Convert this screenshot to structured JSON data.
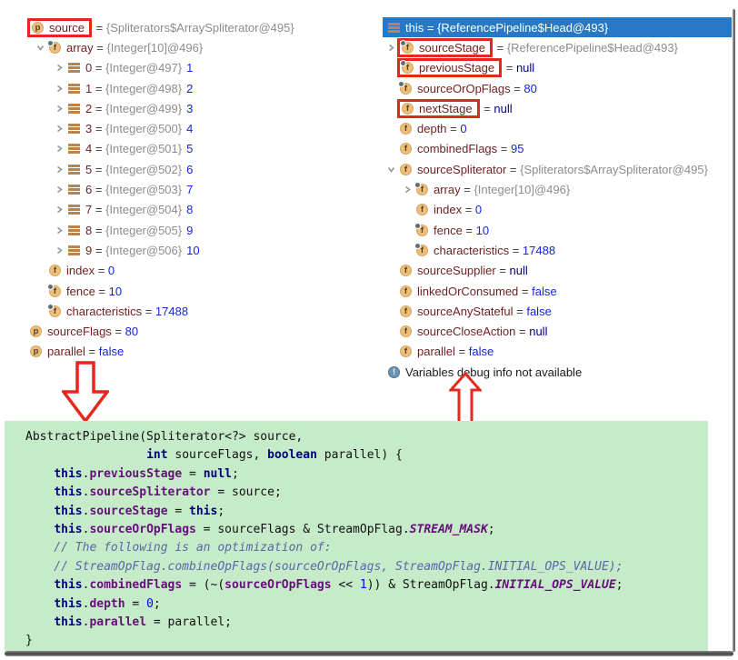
{
  "colors": {
    "selection_bg": "#2779c7",
    "annotation_red": "#e6271c",
    "code_background": "#c6ebc9",
    "icon_background": "#ecbe7a",
    "variable_name": "#6e2222",
    "value_reference": "#8c8c8c",
    "value_primitive": "#1426d8",
    "value_null": "#000080"
  },
  "left_panel": {
    "rows": [
      {
        "pad": 0,
        "icon": "p",
        "name": "source",
        "value": "{Spliterators$ArraySpliterator@495}",
        "vt": "ref",
        "boxed": true
      },
      {
        "pad": 21,
        "chev": "open",
        "icon": "ff",
        "name": "array",
        "value": "{Integer[10]@496}",
        "vt": "ref"
      },
      {
        "pad": 42,
        "chev": "closed",
        "icon": "item",
        "name": "0",
        "value": "{Integer@497}",
        "vt": "ref",
        "extra": "1"
      },
      {
        "pad": 42,
        "chev": "closed",
        "icon": "item",
        "name": "1",
        "value": "{Integer@498}",
        "vt": "ref",
        "extra": "2"
      },
      {
        "pad": 42,
        "chev": "closed",
        "icon": "item",
        "name": "2",
        "value": "{Integer@499}",
        "vt": "ref",
        "extra": "3"
      },
      {
        "pad": 42,
        "chev": "closed",
        "icon": "item",
        "name": "3",
        "value": "{Integer@500}",
        "vt": "ref",
        "extra": "4"
      },
      {
        "pad": 42,
        "chev": "closed",
        "icon": "item",
        "name": "4",
        "value": "{Integer@501}",
        "vt": "ref",
        "extra": "5"
      },
      {
        "pad": 42,
        "chev": "closed",
        "icon": "item",
        "name": "5",
        "value": "{Integer@502}",
        "vt": "ref",
        "extra": "6"
      },
      {
        "pad": 42,
        "chev": "closed",
        "icon": "item",
        "name": "6",
        "value": "{Integer@503}",
        "vt": "ref",
        "extra": "7"
      },
      {
        "pad": 42,
        "chev": "closed",
        "icon": "item",
        "name": "7",
        "value": "{Integer@504}",
        "vt": "ref",
        "extra": "8"
      },
      {
        "pad": 42,
        "chev": "closed",
        "icon": "item",
        "name": "8",
        "value": "{Integer@505}",
        "vt": "ref",
        "extra": "9"
      },
      {
        "pad": 42,
        "chev": "closed",
        "icon": "item",
        "name": "9",
        "value": "{Integer@506}",
        "vt": "ref",
        "extra": "10"
      },
      {
        "pad": 21,
        "icon": "f",
        "name": "index",
        "value": "0",
        "vt": "num"
      },
      {
        "pad": 21,
        "icon": "ff",
        "name": "fence",
        "value": "10",
        "vt": "num"
      },
      {
        "pad": 21,
        "icon": "ff",
        "name": "characteristics",
        "value": "17488",
        "vt": "num"
      },
      {
        "pad": 0,
        "icon": "p",
        "name": "sourceFlags",
        "value": "80",
        "vt": "num"
      },
      {
        "pad": 0,
        "icon": "p",
        "name": "parallel",
        "value": "false",
        "vt": "num"
      }
    ]
  },
  "right_panel": {
    "rows": [
      {
        "selected": true,
        "pad": 6,
        "icon": "this",
        "name": "this",
        "value": "{ReferencePipeline$Head@493}",
        "vt": "ref"
      },
      {
        "pad": 0,
        "chev": "closed",
        "icon": "ff",
        "name": "sourceStage",
        "value": "{ReferencePipeline$Head@493}",
        "vt": "ref",
        "boxed": true
      },
      {
        "pad": 0,
        "icon": "ff",
        "name": "previousStage",
        "value": "null",
        "vt": "null",
        "boxed": true
      },
      {
        "pad": 0,
        "icon": "ff",
        "name": "sourceOrOpFlags",
        "value": "80",
        "vt": "num"
      },
      {
        "pad": 0,
        "icon": "f",
        "name": "nextStage",
        "value": "null",
        "vt": "null",
        "boxed": true
      },
      {
        "pad": 0,
        "icon": "f",
        "name": "depth",
        "value": "0",
        "vt": "num"
      },
      {
        "pad": 0,
        "icon": "f",
        "name": "combinedFlags",
        "value": "95",
        "vt": "num"
      },
      {
        "pad": 0,
        "chev": "open",
        "icon": "f",
        "name": "sourceSpliterator",
        "value": "{Spliterators$ArraySpliterator@495}",
        "vt": "ref"
      },
      {
        "pad": 18,
        "chev": "closed",
        "icon": "ff",
        "name": "array",
        "value": "{Integer[10]@496}",
        "vt": "ref"
      },
      {
        "pad": 18,
        "icon": "f",
        "name": "index",
        "value": "0",
        "vt": "num"
      },
      {
        "pad": 18,
        "icon": "ff",
        "name": "fence",
        "value": "10",
        "vt": "num"
      },
      {
        "pad": 18,
        "icon": "ff",
        "name": "characteristics",
        "value": "17488",
        "vt": "num"
      },
      {
        "pad": 0,
        "icon": "f",
        "name": "sourceSupplier",
        "value": "null",
        "vt": "null"
      },
      {
        "pad": 0,
        "icon": "f",
        "name": "linkedOrConsumed",
        "value": "false",
        "vt": "num"
      },
      {
        "pad": 0,
        "icon": "f",
        "name": "sourceAnyStateful",
        "value": "false",
        "vt": "num"
      },
      {
        "pad": 0,
        "icon": "f",
        "name": "sourceCloseAction",
        "value": "null",
        "vt": "null"
      },
      {
        "pad": 0,
        "icon": "f",
        "name": "parallel",
        "value": "false",
        "vt": "num"
      },
      {
        "info": true,
        "pad": 6,
        "icon": "info",
        "text": "Variables debug info not available"
      }
    ]
  },
  "code_block": {
    "lines": [
      [
        {
          "s": "d",
          "t": "AbstractPipeline(Spliterator<?> source,"
        }
      ],
      [
        {
          "s": "d",
          "t": "                 "
        },
        {
          "s": "k",
          "t": "int"
        },
        {
          "s": "d",
          "t": " sourceFlags, "
        },
        {
          "s": "k",
          "t": "boolean"
        },
        {
          "s": "d",
          "t": " parallel) {"
        }
      ],
      [
        {
          "s": "d",
          "t": "    "
        },
        {
          "s": "k",
          "t": "this"
        },
        {
          "s": "d",
          "t": "."
        },
        {
          "s": "m",
          "t": "previousStage"
        },
        {
          "s": "d",
          "t": " = "
        },
        {
          "s": "k",
          "t": "null"
        },
        {
          "s": "d",
          "t": ";"
        }
      ],
      [
        {
          "s": "d",
          "t": "    "
        },
        {
          "s": "k",
          "t": "this"
        },
        {
          "s": "d",
          "t": "."
        },
        {
          "s": "m",
          "t": "sourceSpliterator"
        },
        {
          "s": "d",
          "t": " = source;"
        }
      ],
      [
        {
          "s": "d",
          "t": "    "
        },
        {
          "s": "k",
          "t": "this"
        },
        {
          "s": "d",
          "t": "."
        },
        {
          "s": "m",
          "t": "sourceStage"
        },
        {
          "s": "d",
          "t": " = "
        },
        {
          "s": "k",
          "t": "this"
        },
        {
          "s": "d",
          "t": ";"
        }
      ],
      [
        {
          "s": "d",
          "t": "    "
        },
        {
          "s": "k",
          "t": "this"
        },
        {
          "s": "d",
          "t": "."
        },
        {
          "s": "m",
          "t": "sourceOrOpFlags"
        },
        {
          "s": "d",
          "t": " = sourceFlags & StreamOpFlag."
        },
        {
          "s": "s",
          "t": "STREAM_MASK"
        },
        {
          "s": "d",
          "t": ";"
        }
      ],
      [
        {
          "s": "c",
          "t": "    // The following is an optimization of:"
        }
      ],
      [
        {
          "s": "c",
          "t": "    // StreamOpFlag.combineOpFlags(sourceOrOpFlags, StreamOpFlag.INITIAL_OPS_VALUE);"
        }
      ],
      [
        {
          "s": "d",
          "t": "    "
        },
        {
          "s": "k",
          "t": "this"
        },
        {
          "s": "d",
          "t": "."
        },
        {
          "s": "m",
          "t": "combinedFlags"
        },
        {
          "s": "d",
          "t": " = (~("
        },
        {
          "s": "m",
          "t": "sourceOrOpFlags"
        },
        {
          "s": "d",
          "t": " << "
        },
        {
          "s": "n",
          "t": "1"
        },
        {
          "s": "d",
          "t": ")) & StreamOpFlag."
        },
        {
          "s": "s",
          "t": "INITIAL_OPS_VALUE"
        },
        {
          "s": "d",
          "t": ";"
        }
      ],
      [
        {
          "s": "d",
          "t": "    "
        },
        {
          "s": "k",
          "t": "this"
        },
        {
          "s": "d",
          "t": "."
        },
        {
          "s": "m",
          "t": "depth"
        },
        {
          "s": "d",
          "t": " = "
        },
        {
          "s": "n",
          "t": "0"
        },
        {
          "s": "d",
          "t": ";"
        }
      ],
      [
        {
          "s": "d",
          "t": "    "
        },
        {
          "s": "k",
          "t": "this"
        },
        {
          "s": "d",
          "t": "."
        },
        {
          "s": "m",
          "t": "parallel"
        },
        {
          "s": "d",
          "t": " = parallel;"
        }
      ],
      [
        {
          "s": "d",
          "t": "}"
        }
      ]
    ]
  }
}
